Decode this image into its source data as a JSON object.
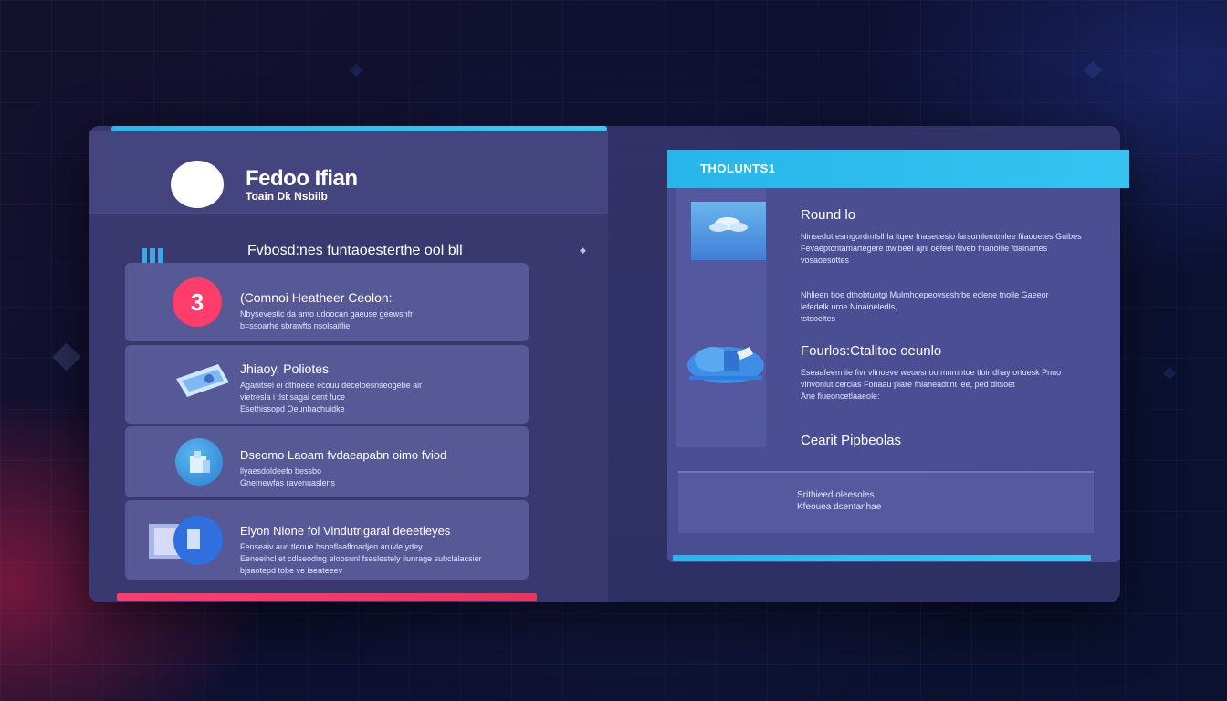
{
  "app": {
    "title": "Fedoo Ifian",
    "subtitle": "Toain Dk Nsbilb"
  },
  "section": {
    "title": "Fvbosd:nes funtaoesterthe ool bll"
  },
  "cards": [
    {
      "title": "(Comnoi Heatheer Ceolon:",
      "lines": [
        "Nbysevestic da amo udoocan gaeuse geewsnfr",
        "b=ssoarhe sbrawfts nsolsaiflie"
      ],
      "icon": "number-badge-icon",
      "badge": "3"
    },
    {
      "title": "Jhiaoy, Poliotes",
      "lines": [
        "Aganitsel ei dthoeee ecouu deceloesnseogebe air",
        "vietresla i tlst sagal cent fuce",
        "Esethissopd Oeunbachuldke"
      ],
      "icon": "ticket-icon"
    },
    {
      "title": "Dseomo Laoam fvdaeapabn oimo fviod",
      "lines": [
        "llyaesdoldeefo   bessbo",
        "Gnemewfas ravenuaslens"
      ],
      "icon": "shield-globe-icon"
    },
    {
      "title": "Elyon Nione fol Vindutrigaral deeetieyes",
      "lines": [
        "Fenseaiv auc tlenue hsneflaaflmadjen aruvle ydey",
        "Eeneeihcl et cdlseoding eloosunl fseslestely liunrage subclalacsier",
        "bjsaotepd tobe ve iseateeev"
      ],
      "icon": "folder-globe-icon"
    }
  ],
  "right": {
    "header": "THOLUNTS1",
    "blocks": [
      {
        "title": "Round lo",
        "lines": [
          "Ninsedut esmgordmfslhla itqee fnasecesjo farsumlemtmlee fiiaooetes Guibes",
          "Fevaeptcntamartegere ttwibeel ajni oefeei fdveb fnanolfie fdainartes",
          "vosaoesottes"
        ]
      },
      {
        "title": "",
        "lines": [
          "Nhlieen boe dthobtuotgi Mulmhoepeovseshrbe eclene tnolle Gaeeor",
          "lefedelk uroe Ninaineledls,",
          "tstsoeltes"
        ]
      },
      {
        "title": "Fourlos:Ctalitoe oeunlo",
        "lines": [
          "Eseaafeem iie fivr vlinoeve weuesnoo mnmntoe tloir dhay ortuesk Pnuo",
          "vinvonlut cerclas Fonaau plare fhianeadtint   iee, ped ditsoet",
          "Ane fiueoncetlaaeole:"
        ]
      },
      {
        "title": "Cearit Pipbeolas",
        "lines": []
      }
    ],
    "summary": {
      "lines": [
        "Srithieed oleesoles",
        "Kfeouea dsentanhae"
      ]
    }
  },
  "colors": {
    "accent_blue": "#2db7e8",
    "accent_red": "#ff3d6a",
    "panel": "#3a3a70"
  }
}
